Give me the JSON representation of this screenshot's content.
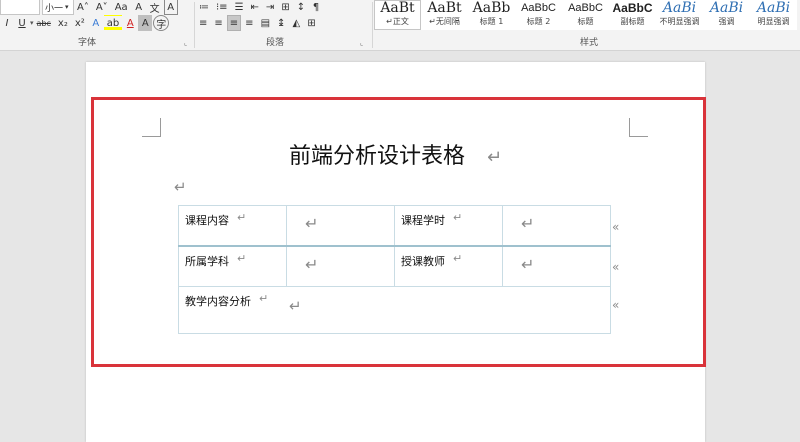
{
  "ribbon": {
    "font": {
      "font_name_value": "",
      "font_size_value": "小一",
      "grow_label": "A˄",
      "shrink_label": "A˅",
      "change_case_label": "Aa",
      "clear_label": "A",
      "phonetic_label": "文",
      "border_char_label": "A",
      "italic_label": "I",
      "underline_label": "U",
      "strike_label": "abc",
      "subscript_label": "x₂",
      "superscript_label": "x²",
      "effects_label": "A",
      "highlight_label": "ab",
      "color_label": "A",
      "shading_label": "A",
      "enclose_label": "字",
      "group_label": "字体"
    },
    "paragraph": {
      "group_label": "段落"
    },
    "styles": {
      "group_label": "样式",
      "items": [
        {
          "sample": "AaBt",
          "name": "↵正文",
          "selected": true
        },
        {
          "sample": "AaBt",
          "name": "↵无间隔",
          "selected": false
        },
        {
          "sample": "AaBb",
          "name": "标题 1",
          "selected": false
        },
        {
          "sample": "AaBbC",
          "name": "标题 2",
          "selected": false
        },
        {
          "sample": "AaBbC",
          "name": "标题",
          "selected": false
        },
        {
          "sample": "AaBbC",
          "name": "副标题",
          "selected": false
        },
        {
          "sample": "AaBi",
          "name": "不明显强调",
          "selected": false
        },
        {
          "sample": "AaBi",
          "name": "强调",
          "selected": false
        },
        {
          "sample": "AaBi",
          "name": "明显强调",
          "selected": false
        }
      ]
    }
  },
  "document": {
    "title": "前端分析设计表格",
    "paragraph_mark": "↵",
    "cell_end_mark": "«",
    "table": {
      "row1": {
        "label1": "课程内容",
        "label2": "课程学时"
      },
      "row2": {
        "label1": "所属学科",
        "label2": "授课教师"
      },
      "row3": {
        "label1": "教学内容分析"
      }
    }
  },
  "colors": {
    "highlight_border": "#d9333a",
    "table_border": "#c9dce4",
    "ribbon_bg": "#f3f3f3",
    "canvas_bg": "#e6e6e6"
  }
}
